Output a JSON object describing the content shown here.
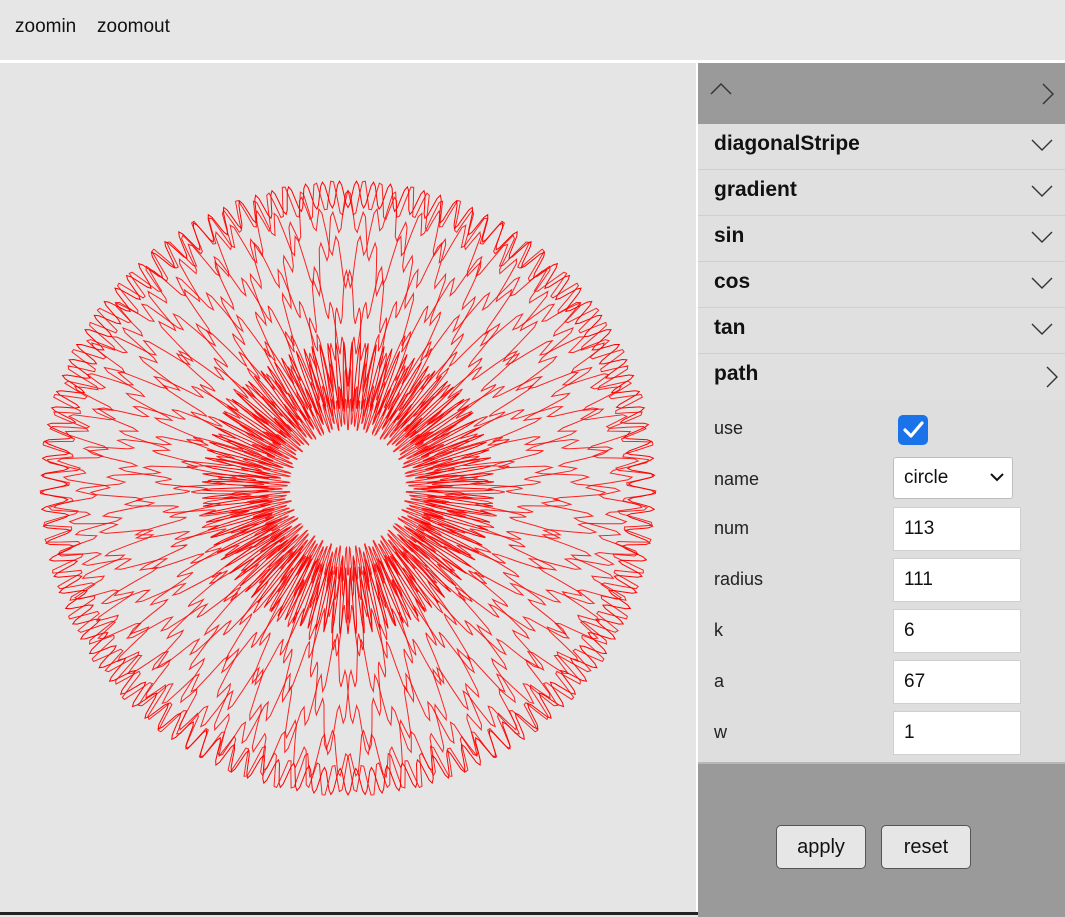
{
  "toolbar": {
    "zoomin": "zoomin",
    "zoomout": "zoomout"
  },
  "canvas": {
    "stroke_color": "#ff0000"
  },
  "panel": {
    "sections": [
      {
        "title": "diagonalStripe",
        "state": "collapsed"
      },
      {
        "title": "gradient",
        "state": "collapsed"
      },
      {
        "title": "sin",
        "state": "collapsed"
      },
      {
        "title": "cos",
        "state": "collapsed"
      },
      {
        "title": "tan",
        "state": "collapsed"
      },
      {
        "title": "path",
        "state": "expanded"
      }
    ],
    "path": {
      "use_label": "use",
      "use_checked": true,
      "name_label": "name",
      "name_value": "circle",
      "num_label": "num",
      "num_value": "113",
      "radius_label": "radius",
      "radius_value": "111",
      "k_label": "k",
      "k_value": "6",
      "a_label": "a",
      "a_value": "67",
      "w_label": "w",
      "w_value": "1"
    },
    "buttons": {
      "apply": "apply",
      "reset": "reset"
    }
  },
  "colors": {
    "accent": "#1a73e8",
    "panel_header": "#9a9a9a",
    "background": "#e6e6e6"
  }
}
